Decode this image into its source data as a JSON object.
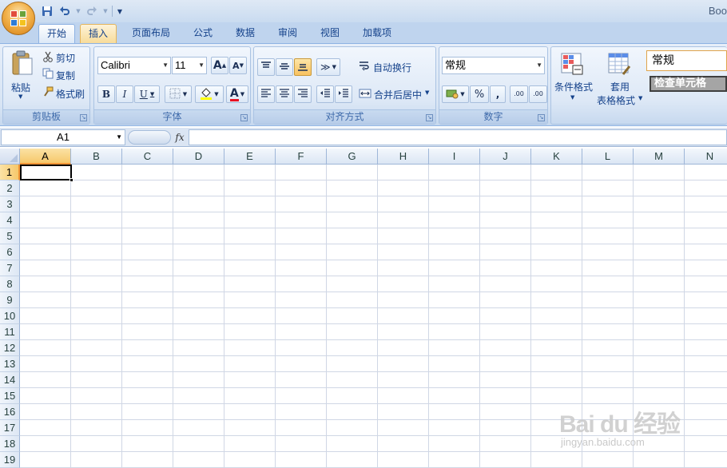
{
  "window": {
    "title_text": "Boo"
  },
  "quick_access": {
    "icons": [
      "save-icon",
      "undo-icon",
      "redo-icon",
      "customize-qat-icon"
    ]
  },
  "tabs": [
    {
      "label": "开始",
      "state": "active"
    },
    {
      "label": "插入",
      "state": "hover"
    },
    {
      "label": "页面布局",
      "state": ""
    },
    {
      "label": "公式",
      "state": ""
    },
    {
      "label": "数据",
      "state": ""
    },
    {
      "label": "审阅",
      "state": ""
    },
    {
      "label": "视图",
      "state": ""
    },
    {
      "label": "加载项",
      "state": ""
    }
  ],
  "ribbon": {
    "clipboard": {
      "group_label": "剪贴板",
      "paste_label": "粘贴",
      "cut_label": "剪切",
      "copy_label": "复制",
      "format_painter_label": "格式刷"
    },
    "font": {
      "group_label": "字体",
      "font_name": "Calibri",
      "font_size": "11",
      "grow_font": "A",
      "shrink_font": "A",
      "bold": "B",
      "italic": "I",
      "underline": "U",
      "font_color_glyph": "A",
      "highlight_color": "#ffff00",
      "font_color": "#e81123"
    },
    "alignment": {
      "group_label": "对齐方式",
      "wrap_text_label": "自动换行",
      "merge_center_label": "合并后居中"
    },
    "number": {
      "group_label": "数字",
      "format_value": "常规",
      "percent": "%",
      "comma": ",",
      "inc_decimal": ".00",
      "dec_decimal": ".00"
    },
    "styles": {
      "conditional_format_label": "条件格式",
      "table_format_label_1": "套用",
      "table_format_label_2": "表格格式",
      "style_normal": "常规",
      "style_check_cell": "检查单元格"
    }
  },
  "formula_bar": {
    "name_box": "A1",
    "fx_label": "fx",
    "formula_value": ""
  },
  "grid": {
    "columns": [
      "A",
      "B",
      "C",
      "D",
      "E",
      "F",
      "G",
      "H",
      "I",
      "J",
      "K",
      "L",
      "M",
      "N"
    ],
    "rows": [
      "1",
      "2",
      "3",
      "4",
      "5",
      "6",
      "7",
      "8",
      "9",
      "10",
      "11",
      "12",
      "13",
      "14",
      "15",
      "16",
      "17",
      "18",
      "19"
    ],
    "active_cell": "A1"
  },
  "watermark": {
    "line1": "Bai du 经验",
    "line2": "jingyan.baidu.com"
  },
  "colors": {
    "ribbon_bg": "#dbe6f5",
    "selected_header": "#f6c86b",
    "gridline": "#d0d7e5"
  }
}
